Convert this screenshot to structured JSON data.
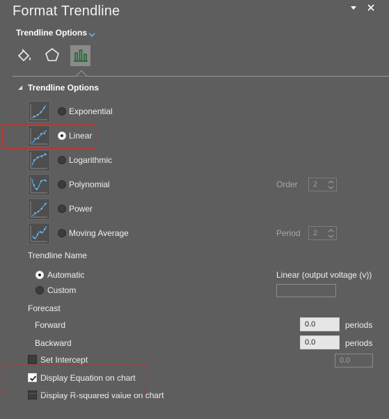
{
  "pane": {
    "title": "Format Trendline",
    "menu_icon": "chevron-down-icon",
    "close_icon": "close-icon",
    "subtitle": "Trendline Options"
  },
  "tabs": [
    {
      "name": "fill-line",
      "icon": "paint-bucket-icon"
    },
    {
      "name": "effects",
      "icon": "pentagon-icon"
    },
    {
      "name": "trendline-options",
      "icon": "bar-chart-icon",
      "active": true
    }
  ],
  "section": {
    "label": "Trendline Options"
  },
  "trend_types": [
    {
      "label": "Exponential",
      "selected": false
    },
    {
      "label": "Linear",
      "selected": true
    },
    {
      "label": "Logarithmic",
      "selected": false
    },
    {
      "label": "Polynomial",
      "selected": false,
      "param_label": "Order",
      "param_value": "2"
    },
    {
      "label": "Power",
      "selected": false
    },
    {
      "label": "Moving Average",
      "selected": false,
      "param_label": "Period",
      "param_value": "2"
    }
  ],
  "trendline_name": {
    "heading": "Trendline Name",
    "automatic_label": "Automatic",
    "automatic_value": "Linear (output voltage (v))",
    "custom_label": "Custom",
    "custom_value": ""
  },
  "forecast": {
    "heading": "Forecast",
    "forward_label": "Forward",
    "forward_value": "0.0",
    "backward_label": "Backward",
    "backward_value": "0.0",
    "unit": "periods"
  },
  "options": {
    "set_intercept_label": "Set Intercept",
    "set_intercept_checked": false,
    "set_intercept_value": "0.0",
    "display_equation_label": "Display Equation on chart",
    "display_equation_checked": true,
    "display_rsquared_label": "Display R-squared value on chart",
    "display_rsquared_checked": false
  },
  "colors": {
    "pane_bg": "#5e5e5e",
    "annotation_red": "#d9261c"
  }
}
